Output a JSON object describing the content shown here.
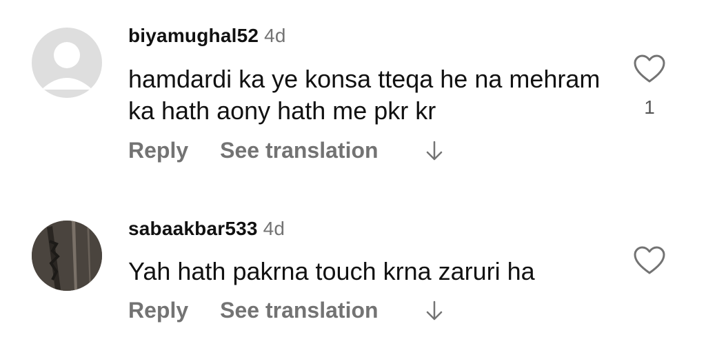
{
  "comments": [
    {
      "username": "biyamughal52",
      "time": "4d",
      "text": "hamdardi ka ye konsa tteqa he na mehram ka hath aony hath me pkr kr",
      "reply_label": "Reply",
      "translate_label": "See translation",
      "likes": "1",
      "avatar": "default-avatar-icon"
    },
    {
      "username": "sabaakbar533",
      "time": "4d",
      "text": "Yah hath pakrna touch krna zaruri ha",
      "reply_label": "Reply",
      "translate_label": "See translation",
      "likes": "",
      "avatar": "profile-photo"
    }
  ],
  "colors": {
    "text": "#111111",
    "muted": "#737373",
    "avatar_placeholder": "#dedede"
  }
}
